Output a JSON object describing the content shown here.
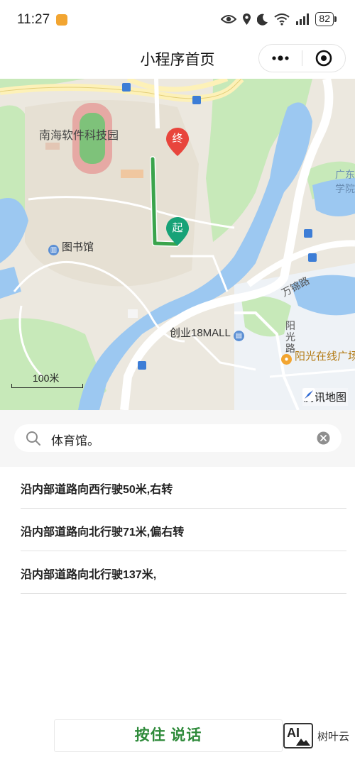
{
  "status_bar": {
    "time": "11:27",
    "battery": "82"
  },
  "nav": {
    "title": "小程序首页"
  },
  "map": {
    "labels": {
      "campus": "南海软件科技园",
      "library": "图书馆",
      "mall": "创业18MALL",
      "road_wanjin": "万锦路",
      "road_yangguang": "阳光路",
      "plaza": "阳光在线广场",
      "college_line1": "广东",
      "college_line2": "学院"
    },
    "markers": {
      "start": "起",
      "end": "终"
    },
    "scale": "100米",
    "provider": "腾讯地图",
    "colors": {
      "route": "#3aa44c",
      "water": "#9cc8f1",
      "green": "#c7e9b9",
      "end_marker": "#e8453c",
      "start_marker": "#17a277"
    }
  },
  "search": {
    "value": "体育馆。"
  },
  "route_steps": [
    "沿内部道路向西行驶50米,右转",
    "沿内部道路向北行驶71米,偏右转",
    "沿内部道路向北行驶137米,"
  ],
  "talk_button": {
    "label": "按住 说话"
  },
  "watermark": {
    "logo_text": "AI",
    "text": "树叶云"
  }
}
